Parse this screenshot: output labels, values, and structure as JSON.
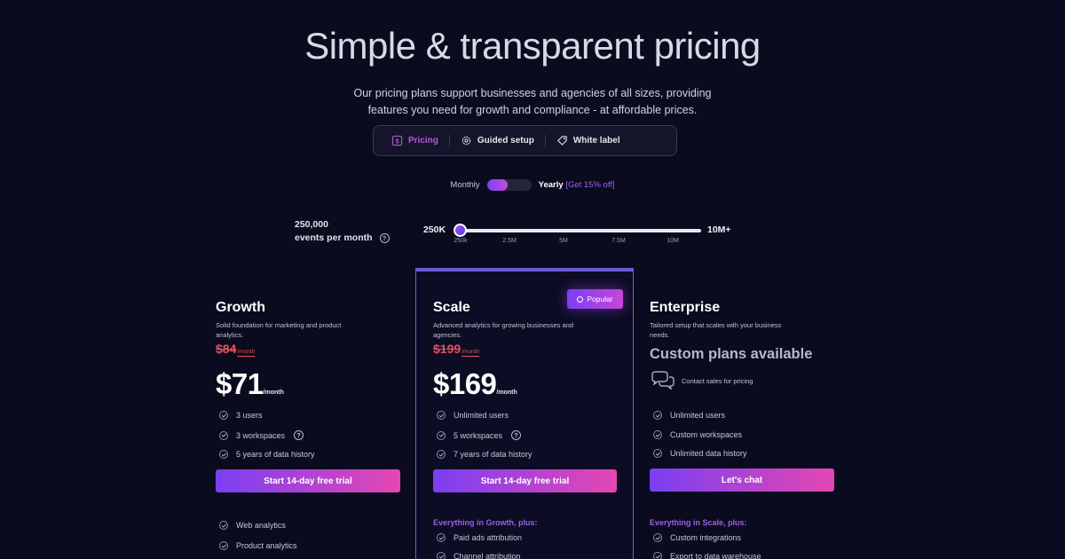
{
  "hero": {
    "title": "Simple & transparent pricing",
    "subtitle_line1": "Our pricing plans support businesses and agencies of all sizes, providing",
    "subtitle_line2": "features you need for growth and compliance - at affordable prices."
  },
  "tabs": [
    {
      "label": "Pricing",
      "icon": "dollar-icon",
      "active": true
    },
    {
      "label": "Guided setup",
      "icon": "gear-icon",
      "active": false
    },
    {
      "label": "White label",
      "icon": "tag-icon",
      "active": false
    }
  ],
  "billing": {
    "monthly_label": "Monthly",
    "yearly_label": "Yearly",
    "discount_label": "[Get 15% off]",
    "selected": "monthly"
  },
  "events": {
    "value": "250,000",
    "unit_label": "events per month",
    "slider_min": "250K",
    "slider_max": "10M+",
    "ticks": [
      "250k",
      "2.5M",
      "5M",
      "7.5M",
      "10M"
    ],
    "position": 0
  },
  "plans": {
    "growth": {
      "name": "Growth",
      "desc": "Solid foundation for marketing and product analytics.",
      "old_price": "$84",
      "old_price_unit": "/month",
      "price": "$71",
      "price_unit": "/month",
      "features": [
        "3 users",
        "3 workspaces",
        "5 years of data history"
      ],
      "cta": "Start 14-day free trial",
      "extra": [
        "Web analytics",
        "Product analytics"
      ]
    },
    "scale": {
      "name": "Scale",
      "badge": "Popular",
      "desc": "Advanced analytics for growing businesses and agencies.",
      "old_price": "$199",
      "old_price_unit": "/month",
      "price": "$169",
      "price_unit": "/month",
      "features": [
        "Unlimited users",
        "5 workspaces",
        "7 years of data history"
      ],
      "cta": "Start 14-day free trial",
      "section_title": "Everything in Growth, plus:",
      "extra": [
        "Paid ads attribution",
        "Channel attribution"
      ]
    },
    "enterprise": {
      "name": "Enterprise",
      "desc": "Tailored setup that scales with your business needs.",
      "custom_label": "Custom plans available",
      "contact_label": "Contact sales for pricing",
      "features": [
        "Unlimited users",
        "Custom workspaces",
        "Unlimited data history"
      ],
      "cta": "Let's chat",
      "section_title": "Everything in Scale, plus:",
      "extra": [
        "Custom integrations",
        "Export to data warehouse"
      ]
    }
  },
  "colors": {
    "background": "#0b0b1f",
    "accent_purple": "#7a3ff3",
    "accent_pink": "#e447b2",
    "old_price_red": "#e8505b",
    "section_purple": "#9d5ee8"
  }
}
